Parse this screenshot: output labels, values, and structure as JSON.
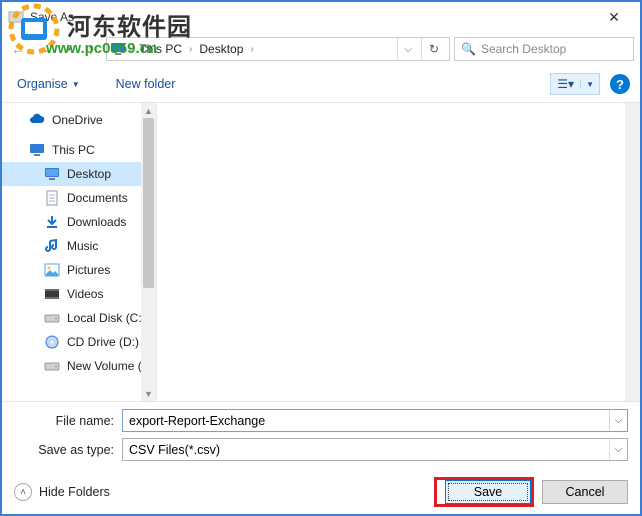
{
  "window": {
    "title": "Save As"
  },
  "watermark": {
    "text1": "河东软件园",
    "text2": "www.pc0359.cn"
  },
  "nav": {
    "path": [
      "This PC",
      "Desktop"
    ],
    "search_placeholder": "Search Desktop"
  },
  "toolbar": {
    "organise": "Organise",
    "newfolder": "New folder"
  },
  "tree": {
    "items": [
      {
        "label": "OneDrive",
        "icon": "cloud",
        "child": false
      },
      {
        "label": "This PC",
        "icon": "pc",
        "child": false
      },
      {
        "label": "Desktop",
        "icon": "desktop",
        "child": true,
        "selected": true
      },
      {
        "label": "Documents",
        "icon": "doc",
        "child": true
      },
      {
        "label": "Downloads",
        "icon": "download",
        "child": true
      },
      {
        "label": "Music",
        "icon": "music",
        "child": true
      },
      {
        "label": "Pictures",
        "icon": "picture",
        "child": true
      },
      {
        "label": "Videos",
        "icon": "video",
        "child": true
      },
      {
        "label": "Local Disk (C:)",
        "icon": "disk",
        "child": true
      },
      {
        "label": "CD Drive (D:) Xer",
        "icon": "cd",
        "child": true
      },
      {
        "label": "New Volume (E:)",
        "icon": "disk",
        "child": true
      }
    ]
  },
  "form": {
    "filename_label": "File name:",
    "filename_value": "export-Report-Exchange",
    "filetype_label": "Save as type:",
    "filetype_value": "CSV Files(*.csv)"
  },
  "buttons": {
    "hide": "Hide Folders",
    "save": "Save",
    "cancel": "Cancel"
  }
}
